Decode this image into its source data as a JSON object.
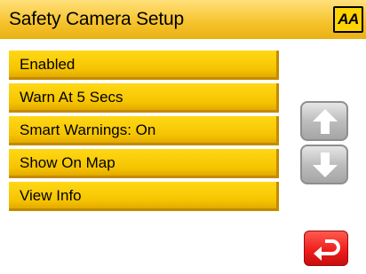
{
  "header": {
    "title": "Safety Camera Setup",
    "logo_text": "AA",
    "icon": "aa-logo-icon"
  },
  "menu": {
    "items": [
      {
        "label": "Enabled"
      },
      {
        "label": "Warn At 5 Secs"
      },
      {
        "label": "Smart Warnings: On"
      },
      {
        "label": "Show On Map"
      },
      {
        "label": "View Info"
      }
    ]
  },
  "controls": {
    "scroll_up_icon": "arrow-up-icon",
    "scroll_down_icon": "arrow-down-icon",
    "back_icon": "return-arrow-icon"
  },
  "colors": {
    "header_yellow": "#f6c22a",
    "button_yellow": "#f7c800",
    "back_red": "#ef1f1f",
    "scroll_grey": "#bdbdbd"
  }
}
